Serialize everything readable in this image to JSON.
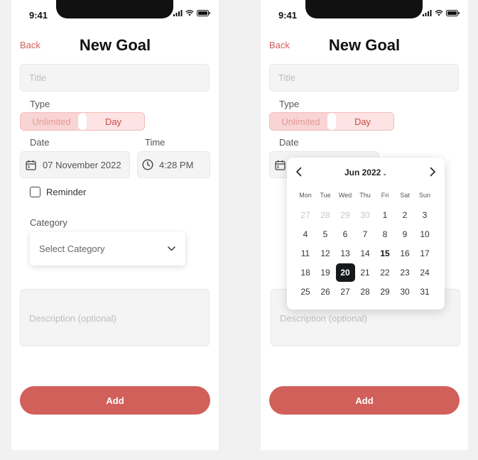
{
  "status": {
    "time": "9:41"
  },
  "header": {
    "back_label": "Back",
    "title": "New Goal"
  },
  "form": {
    "title_placeholder": "Title",
    "type_label": "Type",
    "type_options": [
      "Unlimited",
      "Day"
    ],
    "type_selected": "Day",
    "date_label": "Date",
    "date_value": "07 November 2022",
    "time_label": "Time",
    "time_value": "4:28 PM",
    "reminder_label": "Reminder",
    "reminder_checked": false,
    "category_label": "Category",
    "category_placeholder": "Select Category",
    "description_placeholder": "Description (optional)",
    "add_label": "Add"
  },
  "calendar": {
    "month_label": "Jun 2022",
    "weekdays": [
      "Mon",
      "Tue",
      "Wed",
      "Thu",
      "Fri",
      "Sat",
      "Sun"
    ],
    "days": [
      {
        "d": "27",
        "muted": true
      },
      {
        "d": "28",
        "muted": true
      },
      {
        "d": "29",
        "muted": true
      },
      {
        "d": "30",
        "muted": true
      },
      {
        "d": "1"
      },
      {
        "d": "2"
      },
      {
        "d": "3"
      },
      {
        "d": "4"
      },
      {
        "d": "5"
      },
      {
        "d": "6"
      },
      {
        "d": "7"
      },
      {
        "d": "8"
      },
      {
        "d": "9"
      },
      {
        "d": "10"
      },
      {
        "d": "11"
      },
      {
        "d": "12"
      },
      {
        "d": "13"
      },
      {
        "d": "14"
      },
      {
        "d": "15",
        "today": true
      },
      {
        "d": "16"
      },
      {
        "d": "17"
      },
      {
        "d": "18"
      },
      {
        "d": "19"
      },
      {
        "d": "20",
        "selected": true
      },
      {
        "d": "21"
      },
      {
        "d": "22"
      },
      {
        "d": "23"
      },
      {
        "d": "24"
      },
      {
        "d": "25"
      },
      {
        "d": "26"
      },
      {
        "d": "27"
      },
      {
        "d": "28"
      },
      {
        "d": "29"
      },
      {
        "d": "30"
      },
      {
        "d": "31"
      }
    ]
  },
  "colors": {
    "accent": "#d1605a",
    "toggle_bg": "#fde3e3",
    "selected_day": "#17181c"
  }
}
